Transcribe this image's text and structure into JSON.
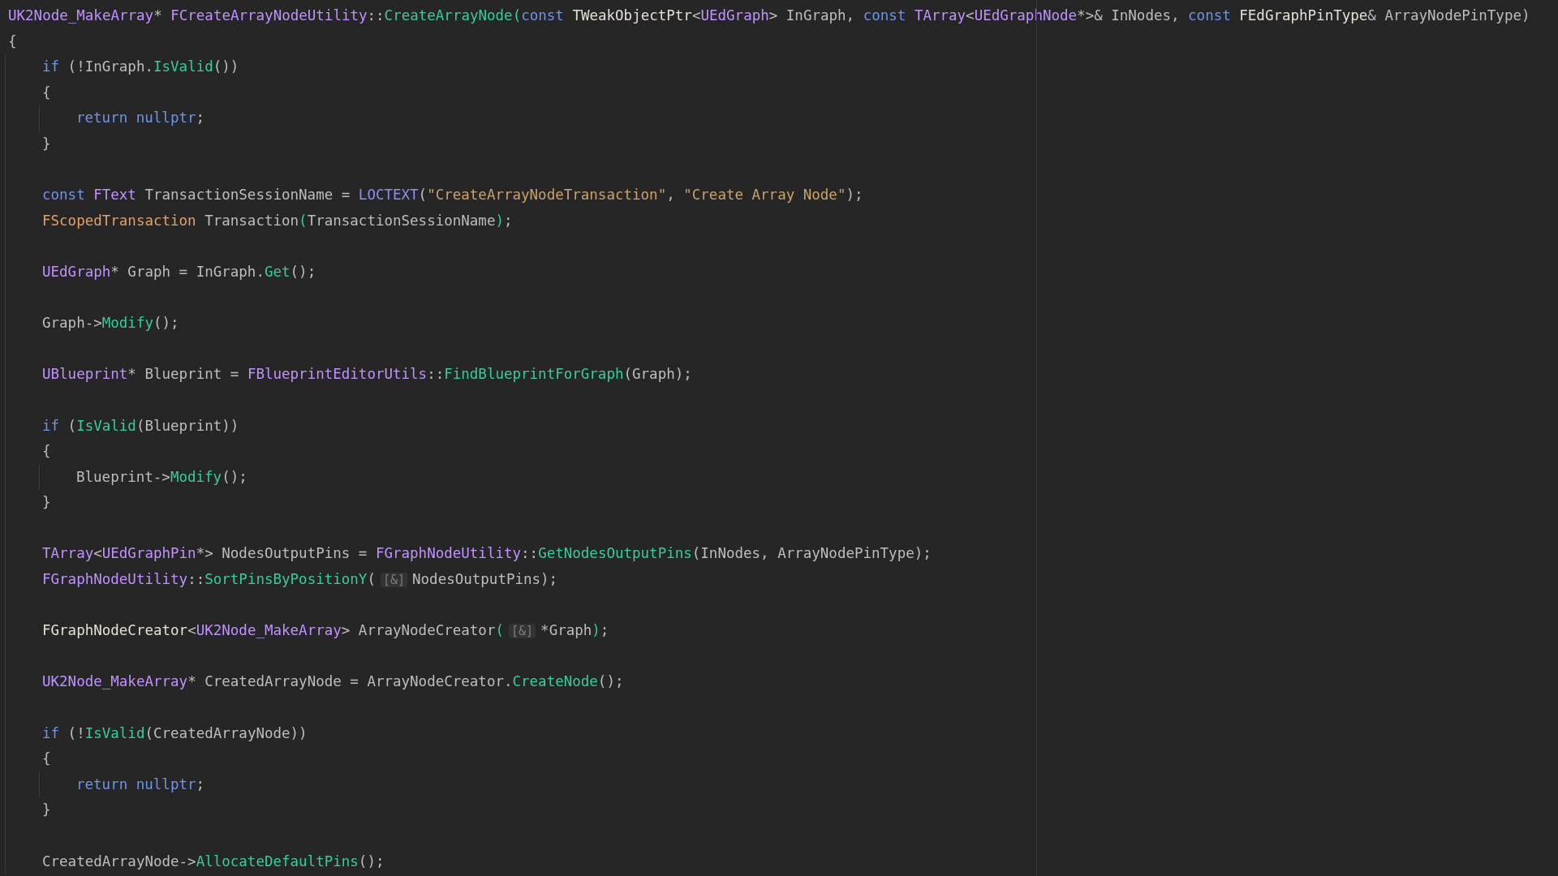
{
  "editor": {
    "lines": [
      {
        "kind": "code",
        "tokens": [
          {
            "kind": "type",
            "text": "UK2Node_MakeArray"
          },
          {
            "kind": "plain",
            "text": "* "
          },
          {
            "kind": "type",
            "text": "FCreateArrayNodeUtility"
          },
          {
            "kind": "plain",
            "text": "::"
          },
          {
            "kind": "func",
            "text": "CreateArrayNode("
          },
          {
            "kind": "keyword",
            "text": "const "
          },
          {
            "kind": "template",
            "text": "TWeakObjectPtr"
          },
          {
            "kind": "plain",
            "text": "<"
          },
          {
            "kind": "type",
            "text": "UEdGraph"
          },
          {
            "kind": "plain",
            "text": "> InGraph, "
          },
          {
            "kind": "keyword",
            "text": "const "
          },
          {
            "kind": "type",
            "text": "TArray"
          },
          {
            "kind": "plain",
            "text": "<"
          },
          {
            "kind": "type",
            "text": "UEdGraphNode"
          },
          {
            "kind": "plain",
            "text": "*>& InNodes, "
          },
          {
            "kind": "keyword",
            "text": "const "
          },
          {
            "kind": "template",
            "text": "FEdGraphPinType"
          },
          {
            "kind": "plain",
            "text": "& ArrayNodePinType)"
          }
        ]
      },
      {
        "kind": "code",
        "tokens": [
          {
            "kind": "plain",
            "text": "{"
          }
        ],
        "children": [
          {
            "kind": "code",
            "tokens": [
              {
                "kind": "keyword",
                "text": "if"
              },
              {
                "kind": "plain",
                "text": " (!InGraph."
              },
              {
                "kind": "func",
                "text": "IsValid"
              },
              {
                "kind": "plain",
                "text": "())"
              }
            ]
          },
          {
            "kind": "code",
            "tokens": [
              {
                "kind": "plain",
                "text": "{"
              }
            ],
            "children": [
              {
                "kind": "code",
                "tokens": [
                  {
                    "kind": "keyword",
                    "text": "return nullptr"
                  },
                  {
                    "kind": "plain",
                    "text": ";"
                  }
                ]
              }
            ]
          },
          {
            "kind": "code",
            "tokens": [
              {
                "kind": "plain",
                "text": "}"
              }
            ]
          },
          {
            "kind": "blank"
          },
          {
            "kind": "code",
            "tokens": [
              {
                "kind": "keyword",
                "text": "const "
              },
              {
                "kind": "type",
                "text": "FText"
              },
              {
                "kind": "plain",
                "text": " TransactionSessionName = "
              },
              {
                "kind": "macro",
                "text": "LOCTEXT"
              },
              {
                "kind": "plain",
                "text": "("
              },
              {
                "kind": "string",
                "text": "\"CreateArrayNodeTransaction\""
              },
              {
                "kind": "plain",
                "text": ", "
              },
              {
                "kind": "string",
                "text": "\"Create Array Node\""
              },
              {
                "kind": "plain",
                "text": ");"
              }
            ]
          },
          {
            "kind": "code",
            "tokens": [
              {
                "kind": "struct",
                "text": "FScopedTransaction"
              },
              {
                "kind": "plain",
                "text": " Transaction"
              },
              {
                "kind": "func",
                "text": "("
              },
              {
                "kind": "plain",
                "text": "TransactionSessionName"
              },
              {
                "kind": "func",
                "text": ")"
              },
              {
                "kind": "plain",
                "text": ";"
              }
            ]
          },
          {
            "kind": "blank"
          },
          {
            "kind": "code",
            "tokens": [
              {
                "kind": "type",
                "text": "UEdGraph"
              },
              {
                "kind": "plain",
                "text": "* Graph = InGraph."
              },
              {
                "kind": "func",
                "text": "Get"
              },
              {
                "kind": "plain",
                "text": "();"
              }
            ]
          },
          {
            "kind": "blank"
          },
          {
            "kind": "code",
            "tokens": [
              {
                "kind": "plain",
                "text": "Graph->"
              },
              {
                "kind": "func",
                "text": "Modify"
              },
              {
                "kind": "plain",
                "text": "();"
              }
            ]
          },
          {
            "kind": "blank"
          },
          {
            "kind": "code",
            "tokens": [
              {
                "kind": "type",
                "text": "UBlueprint"
              },
              {
                "kind": "plain",
                "text": "* Blueprint = "
              },
              {
                "kind": "type",
                "text": "FBlueprintEditorUtils"
              },
              {
                "kind": "plain",
                "text": "::"
              },
              {
                "kind": "func",
                "text": "FindBlueprintForGraph"
              },
              {
                "kind": "plain",
                "text": "(Graph);"
              }
            ]
          },
          {
            "kind": "blank"
          },
          {
            "kind": "code",
            "tokens": [
              {
                "kind": "keyword",
                "text": "if"
              },
              {
                "kind": "plain",
                "text": " ("
              },
              {
                "kind": "func",
                "text": "IsValid"
              },
              {
                "kind": "plain",
                "text": "(Blueprint))"
              }
            ]
          },
          {
            "kind": "code",
            "tokens": [
              {
                "kind": "plain",
                "text": "{"
              }
            ],
            "children": [
              {
                "kind": "code",
                "tokens": [
                  {
                    "kind": "plain",
                    "text": "Blueprint->"
                  },
                  {
                    "kind": "func",
                    "text": "Modify"
                  },
                  {
                    "kind": "plain",
                    "text": "();"
                  }
                ]
              }
            ]
          },
          {
            "kind": "code",
            "tokens": [
              {
                "kind": "plain",
                "text": "}"
              }
            ]
          },
          {
            "kind": "blank"
          },
          {
            "kind": "code",
            "tokens": [
              {
                "kind": "type",
                "text": "TArray"
              },
              {
                "kind": "plain",
                "text": "<"
              },
              {
                "kind": "type",
                "text": "UEdGraphPin"
              },
              {
                "kind": "plain",
                "text": "*> NodesOutputPins = "
              },
              {
                "kind": "type",
                "text": "FGraphNodeUtility"
              },
              {
                "kind": "plain",
                "text": "::"
              },
              {
                "kind": "func",
                "text": "GetNodesOutputPins"
              },
              {
                "kind": "plain",
                "text": "(InNodes, ArrayNodePinType);"
              }
            ]
          },
          {
            "kind": "code",
            "tokens": [
              {
                "kind": "type",
                "text": "FGraphNodeUtility"
              },
              {
                "kind": "plain",
                "text": "::"
              },
              {
                "kind": "func",
                "text": "SortPinsByPositionY"
              },
              {
                "kind": "plain",
                "text": "("
              },
              {
                "kind": "hint",
                "text": "[&]"
              },
              {
                "kind": "plain",
                "text": "NodesOutputPins);"
              }
            ]
          },
          {
            "kind": "blank"
          },
          {
            "kind": "code",
            "tokens": [
              {
                "kind": "template",
                "text": "FGraphNodeCreator"
              },
              {
                "kind": "plain",
                "text": "<"
              },
              {
                "kind": "type",
                "text": "UK2Node_MakeArray"
              },
              {
                "kind": "plain",
                "text": "> ArrayNodeCreator"
              },
              {
                "kind": "func",
                "text": "("
              },
              {
                "kind": "hint",
                "text": "[&]"
              },
              {
                "kind": "plain",
                "text": "*Graph"
              },
              {
                "kind": "func",
                "text": ")"
              },
              {
                "kind": "plain",
                "text": ";"
              }
            ]
          },
          {
            "kind": "blank"
          },
          {
            "kind": "code",
            "tokens": [
              {
                "kind": "type",
                "text": "UK2Node_MakeArray"
              },
              {
                "kind": "plain",
                "text": "* CreatedArrayNode = ArrayNodeCreator."
              },
              {
                "kind": "func",
                "text": "CreateNode"
              },
              {
                "kind": "plain",
                "text": "();"
              }
            ]
          },
          {
            "kind": "blank"
          },
          {
            "kind": "code",
            "tokens": [
              {
                "kind": "keyword",
                "text": "if"
              },
              {
                "kind": "plain",
                "text": " (!"
              },
              {
                "kind": "func",
                "text": "IsValid"
              },
              {
                "kind": "plain",
                "text": "(CreatedArrayNode))"
              }
            ]
          },
          {
            "kind": "code",
            "tokens": [
              {
                "kind": "plain",
                "text": "{"
              }
            ],
            "children": [
              {
                "kind": "code",
                "tokens": [
                  {
                    "kind": "keyword",
                    "text": "return nullptr"
                  },
                  {
                    "kind": "plain",
                    "text": ";"
                  }
                ]
              }
            ]
          },
          {
            "kind": "code",
            "tokens": [
              {
                "kind": "plain",
                "text": "}"
              }
            ]
          },
          {
            "kind": "blank"
          },
          {
            "kind": "code",
            "tokens": [
              {
                "kind": "plain",
                "text": "CreatedArrayNode->"
              },
              {
                "kind": "func",
                "text": "AllocateDefaultPins"
              },
              {
                "kind": "plain",
                "text": "();"
              }
            ]
          }
        ]
      }
    ]
  }
}
